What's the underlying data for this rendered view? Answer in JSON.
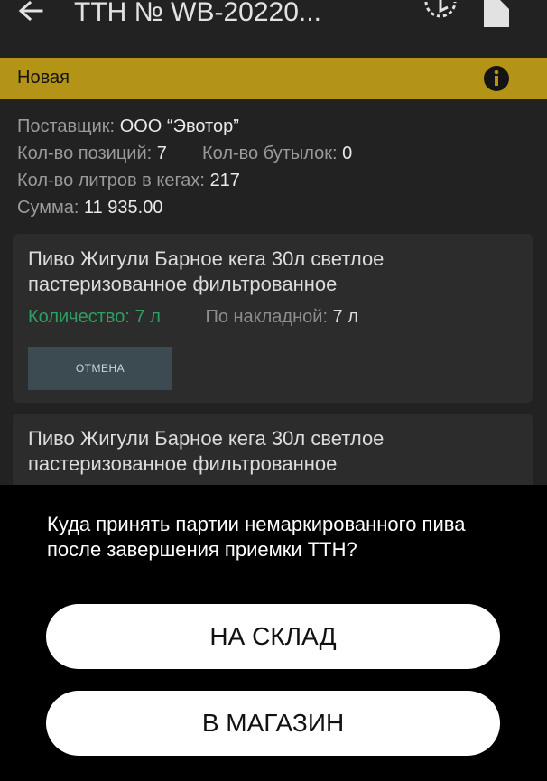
{
  "appbar": {
    "title": "ТТН № WB-20220...",
    "icons": [
      "back-arrow-icon",
      "history-icon",
      "document-icon"
    ]
  },
  "status": {
    "label": "Новая",
    "color": "#b49416",
    "info_icon": "info-icon"
  },
  "summary": {
    "supplier_label": "Поставщик:",
    "supplier_value": "ООО “Эвотор”",
    "positions_label": "Кол-во позиций:",
    "positions_value": "7",
    "bottles_label": "Кол-во бутылок:",
    "bottles_value": "0",
    "liters_label": "Кол-во литров в кегах:",
    "liters_value": "217",
    "sum_label": "Сумма:",
    "sum_value": "11 935.00"
  },
  "items": [
    {
      "name": "Пиво Жигули Барное кега 30л светлое пастеризованное фильтрованное",
      "qty_label": "Количество: 7 л",
      "invoice_label": "По накладной:",
      "invoice_value": "7 л",
      "cancel_label": "ОТМЕНА"
    },
    {
      "name": "Пиво Жигули Барное кега 30л светлое пастеризованное фильтрованное"
    }
  ],
  "sheet": {
    "question": "Куда принять партии немаркированного пива после завершения приемки ТТН?",
    "option_warehouse": "НА СКЛАД",
    "option_store": "В МАГАЗИН"
  },
  "colors": {
    "background": "#222222",
    "card": "#2c2c2c",
    "accent_green": "#2e9e62",
    "sheet": "#000000"
  }
}
